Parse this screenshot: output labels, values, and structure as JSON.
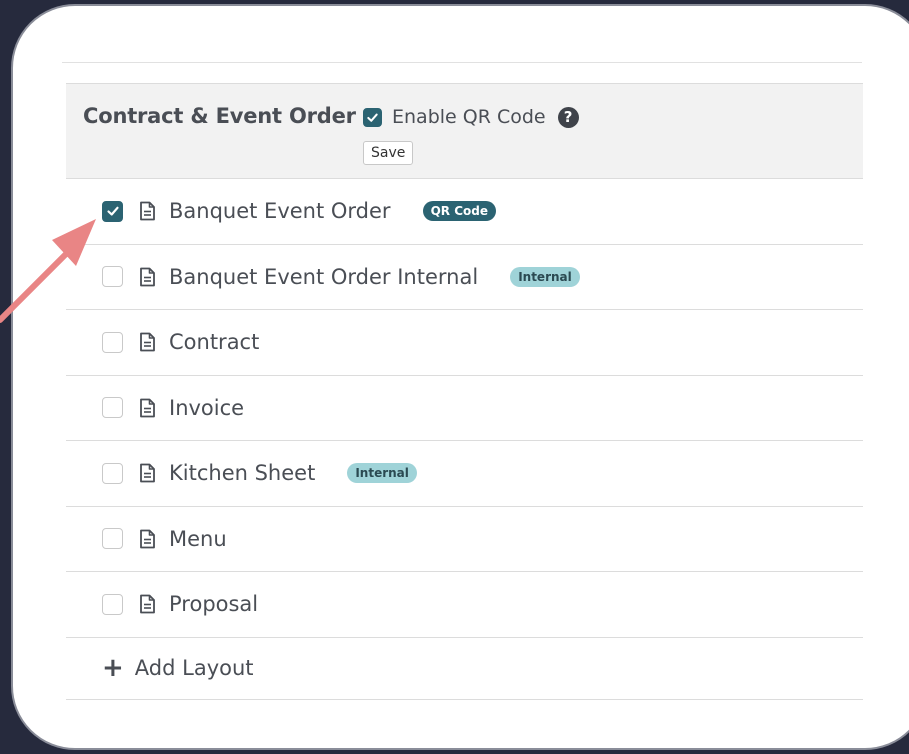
{
  "panel": {
    "title": "Contract & Event Order",
    "enable_qr_label": "Enable QR Code",
    "enable_qr_checked": true,
    "save_label": "Save"
  },
  "layouts": [
    {
      "name": "Banquet Event Order",
      "checked": true,
      "badge": "QR Code",
      "badge_type": "qr"
    },
    {
      "name": "Banquet Event Order Internal",
      "checked": false,
      "badge": "Internal",
      "badge_type": "internal"
    },
    {
      "name": "Contract",
      "checked": false,
      "badge": "",
      "badge_type": ""
    },
    {
      "name": "Invoice",
      "checked": false,
      "badge": "",
      "badge_type": ""
    },
    {
      "name": "Kitchen Sheet",
      "checked": false,
      "badge": "Internal",
      "badge_type": "internal"
    },
    {
      "name": "Menu",
      "checked": false,
      "badge": "",
      "badge_type": ""
    },
    {
      "name": "Proposal",
      "checked": false,
      "badge": "",
      "badge_type": ""
    }
  ],
  "add_layout_label": "Add Layout",
  "colors": {
    "accent": "#2b6372",
    "internal_badge": "#9fd3d8",
    "arrow": "#e98585",
    "backdrop": "#262a3d"
  },
  "icons": {
    "document": "document-icon",
    "plus": "plus-icon",
    "help": "question-circle-icon",
    "check": "check-icon"
  }
}
